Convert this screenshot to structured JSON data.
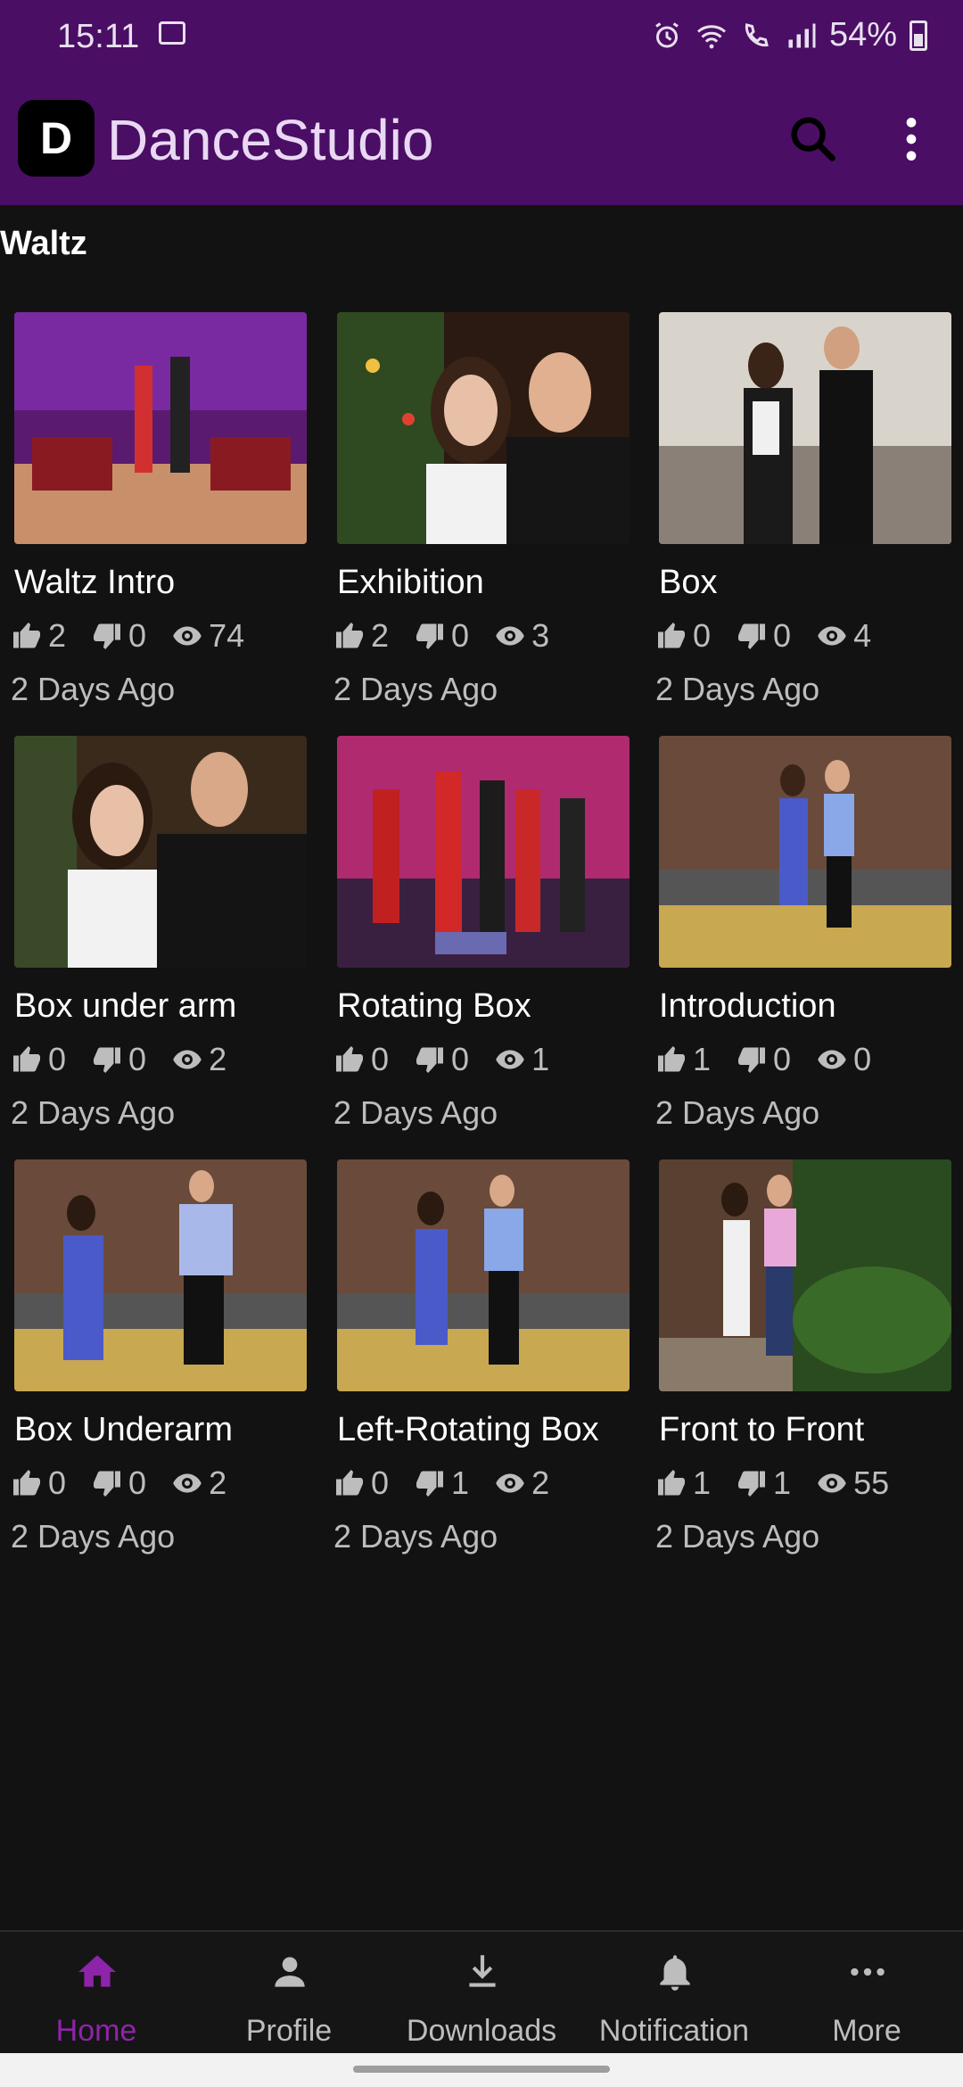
{
  "status": {
    "time": "15:11",
    "battery": "54%"
  },
  "app": {
    "title": "DanceStudio",
    "logo_letter": "D"
  },
  "section": {
    "title": "Waltz"
  },
  "videos": [
    {
      "title": "Waltz Intro",
      "likes": "2",
      "dislikes": "0",
      "views": "74",
      "ago": "2 Days Ago"
    },
    {
      "title": "Exhibition",
      "likes": "2",
      "dislikes": "0",
      "views": "3",
      "ago": "2 Days Ago"
    },
    {
      "title": "Box",
      "likes": "0",
      "dislikes": "0",
      "views": "4",
      "ago": "2 Days Ago"
    },
    {
      "title": "Box under arm",
      "likes": "0",
      "dislikes": "0",
      "views": "2",
      "ago": "2 Days Ago"
    },
    {
      "title": "Rotating Box",
      "likes": "0",
      "dislikes": "0",
      "views": "1",
      "ago": "2 Days Ago"
    },
    {
      "title": "Introduction",
      "likes": "1",
      "dislikes": "0",
      "views": "0",
      "ago": "2 Days Ago"
    },
    {
      "title": "Box Underarm",
      "likes": "0",
      "dislikes": "0",
      "views": "2",
      "ago": "2 Days Ago"
    },
    {
      "title": "Left-Rotating Box",
      "likes": "0",
      "dislikes": "1",
      "views": "2",
      "ago": "2 Days Ago"
    },
    {
      "title": "Front to Front",
      "likes": "1",
      "dislikes": "1",
      "views": "55",
      "ago": "2 Days Ago"
    }
  ],
  "nav": [
    {
      "label": "Home",
      "icon": "home-icon"
    },
    {
      "label": "Profile",
      "icon": "person-icon"
    },
    {
      "label": "Downloads",
      "icon": "download-icon"
    },
    {
      "label": "Notification",
      "icon": "bell-icon"
    },
    {
      "label": "More",
      "icon": "more-horizontal-icon"
    }
  ],
  "colors": {
    "appbar": "#4a0e64",
    "background": "#121212",
    "accent": "#8e24aa"
  }
}
